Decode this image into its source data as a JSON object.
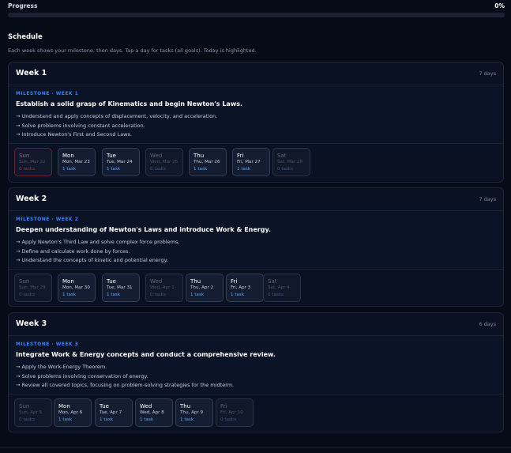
{
  "progress": {
    "label": "Progress",
    "value_text": "0%",
    "fraction": 0.0
  },
  "schedule": {
    "title": "Schedule",
    "subtitle": "Each week shows your milestone, then days. Tap a day for tasks (all goals). Today is highlighted."
  },
  "weeks": [
    {
      "title": "Week 1",
      "days_count": "7 days",
      "milestone_tag": "MILESTONE · WEEK 1",
      "milestone_title": "Establish a solid grasp of Kinematics and begin Newton's Laws.",
      "objectives": [
        "→ Understand and apply concepts of displacement, velocity, and acceleration.",
        "→ Solve problems involving constant acceleration.",
        "→ Introduce Newton's First and Second Laws."
      ],
      "days": [
        {
          "name": "Sun",
          "date": "Sun, Mar 22",
          "tasks": "0 tasks",
          "state": "today"
        },
        {
          "name": "Mon",
          "date": "Mon, Mar 23",
          "tasks": "1 task",
          "state": "active"
        },
        {
          "name": "Tue",
          "date": "Tue, Mar 24",
          "tasks": "1 task",
          "state": "active"
        },
        {
          "name": "Wed",
          "date": "Wed, Mar 25",
          "tasks": "0 tasks",
          "state": "empty"
        },
        {
          "name": "Thu",
          "date": "Thu, Mar 26",
          "tasks": "1 task",
          "state": "active"
        },
        {
          "name": "Fri",
          "date": "Fri, Mar 27",
          "tasks": "1 task",
          "state": "active"
        },
        {
          "name": "Sat",
          "date": "Sat, Mar 28",
          "tasks": "0 tasks",
          "state": "empty"
        }
      ]
    },
    {
      "title": "Week 2",
      "days_count": "7 days",
      "milestone_tag": "MILESTONE · WEEK 2",
      "milestone_title": "Deepen understanding of Newton's Laws and introduce Work & Energy.",
      "objectives": [
        "→ Apply Newton's Third Law and solve complex force problems.",
        "→ Define and calculate work done by forces.",
        "→ Understand the concepts of kinetic and potential energy."
      ],
      "days": [
        {
          "name": "Sun",
          "date": "Sun, Mar 29",
          "tasks": "0 tasks",
          "state": "empty"
        },
        {
          "name": "Mon",
          "date": "Mon, Mar 30",
          "tasks": "1 task",
          "state": "active"
        },
        {
          "name": "Tue",
          "date": "Tue, Mar 31",
          "tasks": "1 task",
          "state": "active"
        },
        {
          "name": "Wed",
          "date": "Wed, Apr 1",
          "tasks": "0 tasks",
          "state": "empty"
        },
        {
          "name": "Thu",
          "date": "Thu, Apr 2",
          "tasks": "1 task",
          "state": "active"
        },
        {
          "name": "Fri",
          "date": "Fri, Apr 3",
          "tasks": "1 task",
          "state": "active"
        },
        {
          "name": "Sat",
          "date": "Sat, Apr 4",
          "tasks": "0 tasks",
          "state": "empty"
        }
      ]
    },
    {
      "title": "Week 3",
      "days_count": "6 days",
      "milestone_tag": "MILESTONE · WEEK 3",
      "milestone_title": "Integrate Work & Energy concepts and conduct a comprehensive review.",
      "objectives": [
        "→ Apply the Work-Energy Theorem.",
        "→ Solve problems involving conservation of energy.",
        "→ Review all covered topics, focusing on problem-solving strategies for the midterm."
      ],
      "days": [
        {
          "name": "Sun",
          "date": "Sun, Apr 5",
          "tasks": "0 tasks",
          "state": "empty"
        },
        {
          "name": "Mon",
          "date": "Mon, Apr 6",
          "tasks": "1 task",
          "state": "active"
        },
        {
          "name": "Tue",
          "date": "Tue, Apr 7",
          "tasks": "1 task",
          "state": "active"
        },
        {
          "name": "Wed",
          "date": "Wed, Apr 8",
          "tasks": "1 task",
          "state": "active"
        },
        {
          "name": "Thu",
          "date": "Thu, Apr 9",
          "tasks": "1 task",
          "state": "active"
        },
        {
          "name": "Fri",
          "date": "Fri, Apr 10",
          "tasks": "0 tasks",
          "state": "empty"
        }
      ]
    }
  ],
  "colors": {
    "accent": "#3b82f6",
    "background": "#060b18",
    "today_border": "#6b2230"
  }
}
